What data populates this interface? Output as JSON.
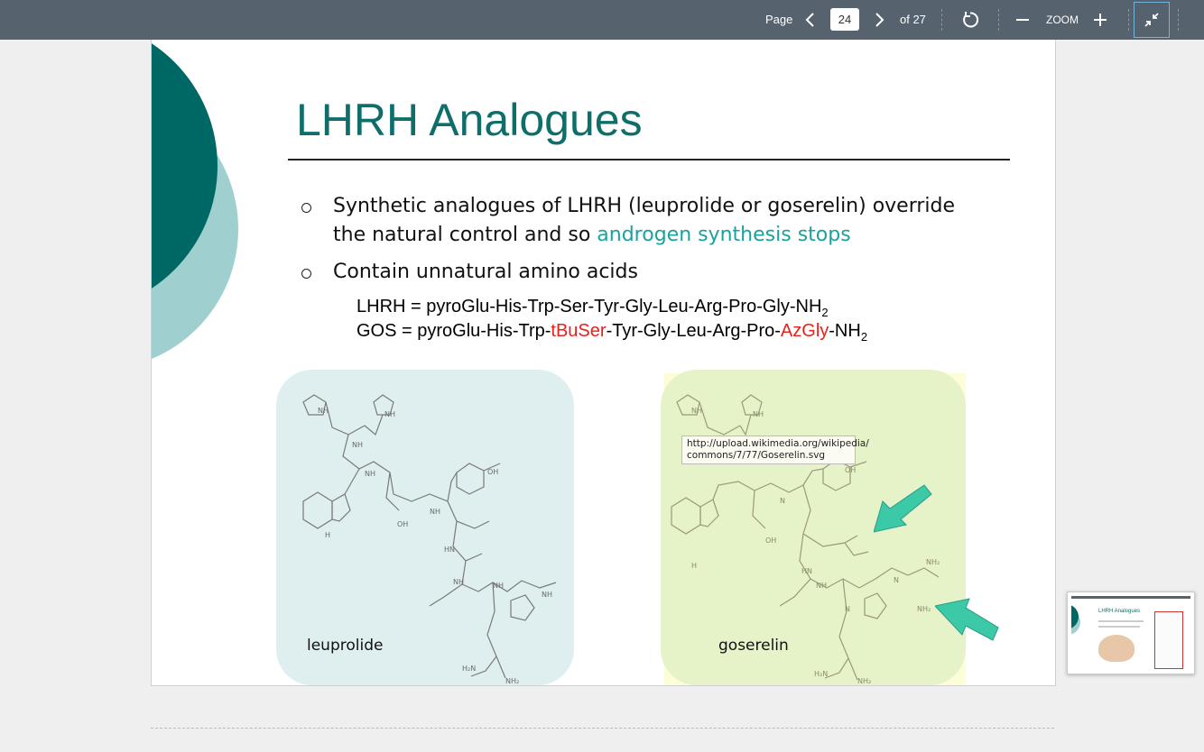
{
  "toolbar": {
    "page_label": "Page",
    "current_page": "24",
    "total_pages": "of 27",
    "zoom_label": "ZOOM"
  },
  "slide": {
    "title": "LHRH Analogues",
    "bullets": [
      {
        "line1": "Synthetic analogues of LHRH (leuprolide or goserelin) override",
        "line2_prefix": "the natural control and so ",
        "line2_highlight": "androgen synthesis stops"
      },
      {
        "line1": "Contain unnatural amino acids"
      }
    ],
    "lhrh": {
      "prefix": "LHRH = pyroGlu-His-Trp-Ser-Tyr-Gly-Leu-Arg-Pro-Gly-NH",
      "sub": "2"
    },
    "gos": {
      "prefix": "GOS = pyroGlu-His-Trp-",
      "mod1": "tBuSer",
      "middle": "-Tyr-Gly-Leu-Arg-Pro-",
      "mod2": "AzGly",
      "suffix": "-NH",
      "sub": "2"
    },
    "molecules": [
      {
        "label": "leuprolide"
      },
      {
        "label": "goserelin"
      }
    ],
    "tooltip": {
      "line1": "http://upload.wikimedia.org/wikipedia/",
      "line2": "commons/7/77/Goserelin.svg"
    }
  },
  "thumbnail": {
    "title": "LHRH Analogues"
  },
  "colors": {
    "toolbar": "#56636f",
    "title": "#0e6e6a",
    "highlight_teal": "#1aa29c",
    "mod_red": "#e8211c",
    "panel_left": "#dfeeee",
    "panel_right": "#e6f2c8",
    "arrow": "#3cc9a8"
  }
}
